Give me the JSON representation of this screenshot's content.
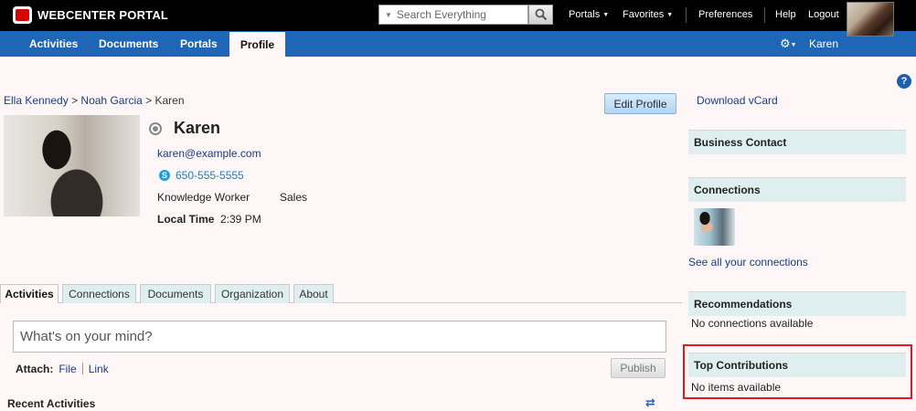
{
  "app": {
    "brand": "WEBCENTER PORTAL"
  },
  "topbar": {
    "search_placeholder": "Search Everything",
    "links": {
      "portals": "Portals",
      "favorites": "Favorites",
      "preferences": "Preferences",
      "help": "Help",
      "logout": "Logout"
    }
  },
  "nav": {
    "tabs": [
      "Activities",
      "Documents",
      "Portals"
    ],
    "active_tab": "Profile",
    "user": "Karen"
  },
  "breadcrumb": {
    "items": [
      "Ella Kennedy",
      "Noah Garcia"
    ],
    "separator": ">",
    "current": "Karen"
  },
  "profile": {
    "name": "Karen",
    "email": "karen@example.com",
    "phone": "650-555-5555",
    "job": "Knowledge Worker",
    "department": "Sales",
    "local_time_label": "Local Time",
    "local_time": "2:39 PM",
    "edit_button": "Edit Profile"
  },
  "tabs": {
    "active": "Activities",
    "items": [
      "Connections",
      "Documents",
      "Organization",
      "About"
    ]
  },
  "activity": {
    "placeholder": "What's on your mind?",
    "attach_label": "Attach:",
    "attach_file": "File",
    "attach_link": "Link",
    "publish": "Publish",
    "recent_title": "Recent Activities"
  },
  "sidebar": {
    "download_vcard": "Download vCard",
    "business_contact": "Business Contact",
    "connections_title": "Connections",
    "see_all": "See all your connections",
    "recommendations_title": "Recommendations",
    "recommendations_empty": "No connections available",
    "top_contrib_title": "Top Contributions",
    "top_contrib_empty": "No items available"
  },
  "colors": {
    "nav_blue": "#1f66b7",
    "highlight_red": "#e31a1c",
    "panel_header": "#dfeeee"
  }
}
